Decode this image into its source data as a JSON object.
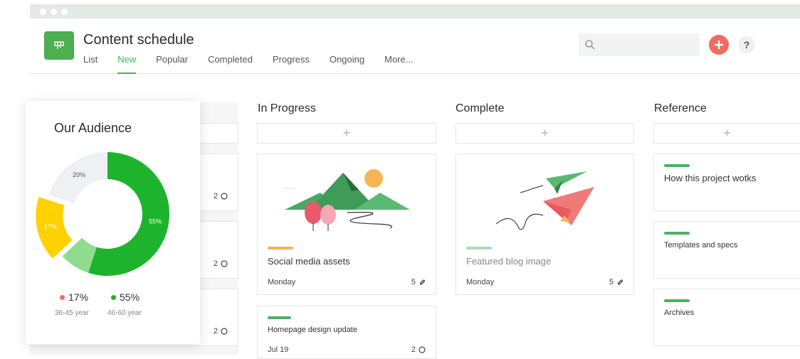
{
  "header": {
    "title": "Content schedule",
    "tabs": [
      "List",
      "New",
      "Popular",
      "Completed",
      "Progress",
      "Ongoing",
      "More..."
    ],
    "active_tab": "New",
    "help_label": "?"
  },
  "columns": {
    "in_progress": {
      "title": "In Progress",
      "add_label": "+",
      "cards": [
        {
          "title": "Social media assets",
          "date": "Monday",
          "count": "5",
          "bar_color": "#f7b15a"
        },
        {
          "title": "Homepage design update",
          "date": "Jul 19",
          "count": "2",
          "bar_color": "#48b263"
        }
      ]
    },
    "complete": {
      "title": "Complete",
      "add_label": "+",
      "cards": [
        {
          "title": "Featured blog image",
          "date": "Monday",
          "count": "5",
          "bar_color": "#a8dcb6"
        }
      ]
    },
    "reference": {
      "title": "Reference",
      "add_label": "+",
      "cards": [
        {
          "title": "How this project wotks",
          "bar_color": "#48b263"
        },
        {
          "title": "Templates and specs",
          "bar_color": "#48b263"
        },
        {
          "title": "Archives",
          "bar_color": "#48b263"
        }
      ]
    },
    "hidden": {
      "counts": [
        "2",
        "2",
        "2"
      ]
    }
  },
  "audience": {
    "title": "Our Audience",
    "segments": [
      {
        "label": "55%",
        "value": 55,
        "color": "#1db32c"
      },
      {
        "label": "",
        "value": 8,
        "color": "#8fdc8f"
      },
      {
        "label": "17%",
        "value": 17,
        "color": "#ffd100"
      },
      {
        "label": "20%",
        "value": 20,
        "color": "#eef0f4"
      }
    ],
    "legend": [
      {
        "value": "17%",
        "label": "36-45 year",
        "color": "#f26b6b"
      },
      {
        "value": "55%",
        "label": "46-60 year",
        "color": "#1db32c"
      }
    ]
  },
  "colors": {
    "accent": "#3bb55a",
    "add_button": "#f26b5e",
    "logo": "#4caf50"
  },
  "icons": {
    "logo": "board-icon",
    "search": "search-icon",
    "add": "plus-icon",
    "attachment": "paperclip-icon",
    "comment": "comment-icon"
  }
}
